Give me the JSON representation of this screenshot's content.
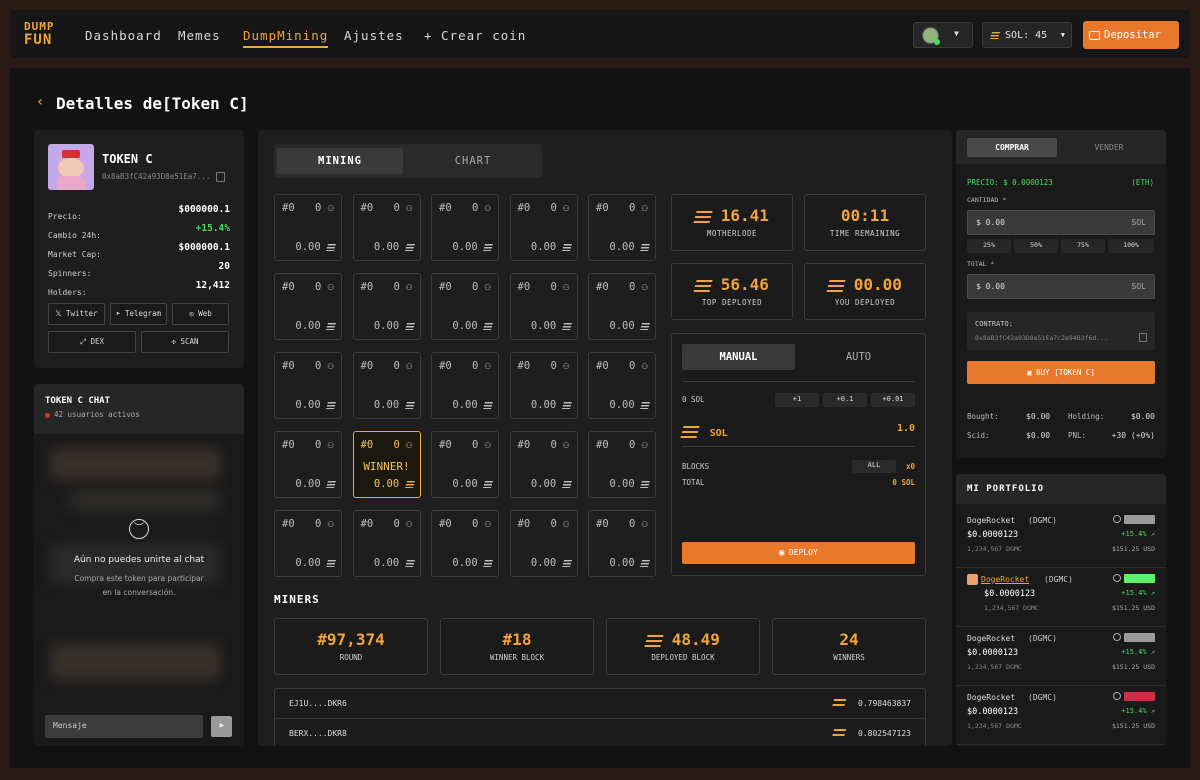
{
  "nav": {
    "logo_top": "DUMP",
    "logo_bottom": "FUN",
    "items": [
      "Dashboard",
      "Memes",
      "DumpMining",
      "Ajustes"
    ],
    "create": "+ Crear coin",
    "sol": "SOL: 45",
    "deposit": "Depositar"
  },
  "page": {
    "title": "Detalles de[Token C]"
  },
  "token": {
    "name": "TOKEN C",
    "address": "0x8aB3fC42a93D8e51Ea7...",
    "stats": [
      {
        "label": "Precio:",
        "value": "$000000.1"
      },
      {
        "label": "Cambio 24h:",
        "value": "+15.4%"
      },
      {
        "label": "Market Cap:",
        "value": "$000000.1"
      },
      {
        "label": "Spinners:",
        "value": "20"
      },
      {
        "label": "Holders:",
        "value": "12,412"
      }
    ],
    "links": [
      "Twitter",
      "Telegram",
      "Web",
      "DEX",
      "SCAN"
    ]
  },
  "chat": {
    "title": "TOKEN C CHAT",
    "active": "42 usuarios activos",
    "locked_title": "Aún no puedes unirte al chat",
    "locked_sub1": "Compra este token para participar",
    "locked_sub2": "en la conversación.",
    "placeholder": "Mensaje"
  },
  "tabs": {
    "mining": "MINING",
    "chart": "CHART"
  },
  "grid": {
    "cells": [
      {
        "id": "#0",
        "count": "0",
        "amount": "0.00"
      },
      {
        "id": "#0",
        "count": "0",
        "amount": "0.00"
      },
      {
        "id": "#0",
        "count": "0",
        "amount": "0.00"
      },
      {
        "id": "#0",
        "count": "0",
        "amount": "0.00"
      },
      {
        "id": "#0",
        "count": "0",
        "amount": "0.00"
      },
      {
        "id": "#0",
        "count": "0",
        "amount": "0.00"
      },
      {
        "id": "#0",
        "count": "0",
        "amount": "0.00"
      },
      {
        "id": "#0",
        "count": "0",
        "amount": "0.00"
      },
      {
        "id": "#0",
        "count": "0",
        "amount": "0.00"
      },
      {
        "id": "#0",
        "count": "0",
        "amount": "0.00"
      },
      {
        "id": "#0",
        "count": "0",
        "amount": "0.00"
      },
      {
        "id": "#0",
        "count": "0",
        "amount": "0.00"
      },
      {
        "id": "#0",
        "count": "0",
        "amount": "0.00"
      },
      {
        "id": "#0",
        "count": "0",
        "amount": "0.00"
      },
      {
        "id": "#0",
        "count": "0",
        "amount": "0.00"
      },
      {
        "id": "#0",
        "count": "0",
        "amount": "0.00"
      },
      {
        "id": "#0",
        "count": "0",
        "amount": "0.00",
        "winner": "WINNER!"
      },
      {
        "id": "#0",
        "count": "0",
        "amount": "0.00"
      },
      {
        "id": "#0",
        "count": "0",
        "amount": "0.00"
      },
      {
        "id": "#0",
        "count": "0",
        "amount": "0.00"
      },
      {
        "id": "#0",
        "count": "0",
        "amount": "0.00"
      },
      {
        "id": "#0",
        "count": "0",
        "amount": "0.00"
      },
      {
        "id": "#0",
        "count": "0",
        "amount": "0.00"
      },
      {
        "id": "#0",
        "count": "0",
        "amount": "0.00"
      },
      {
        "id": "#0",
        "count": "0",
        "amount": "0.00"
      }
    ]
  },
  "stats": [
    {
      "value": "16.41",
      "label": "MOTHERLODE"
    },
    {
      "value": "00:11",
      "label": "TIME REMAINING"
    },
    {
      "value": "56.46",
      "label": "TOP DEPLOYED"
    },
    {
      "value": "00.00",
      "label": "YOU DEPLOYED"
    }
  ],
  "deploy": {
    "manual": "MANUAL",
    "auto": "AUTO",
    "sol_label": "0 SOL",
    "increments": [
      "+1",
      "+0.1",
      "+0.01"
    ],
    "sol": "SOL",
    "amount": "1.0",
    "blocks_label": "BLOCKS",
    "all": "ALL",
    "blocks_value": "x0",
    "total_label": "TOTAL",
    "total_value": "0 SOL",
    "button": "DEPLOY"
  },
  "miners": {
    "title": "MINERS",
    "stats": [
      {
        "value": "#97,374",
        "label": "ROUND"
      },
      {
        "value": "#18",
        "label": "WINNER BLOCK"
      },
      {
        "value": "48.49",
        "label": "DEPLOYED BLOCK"
      },
      {
        "value": "24",
        "label": "WINNERS"
      }
    ],
    "rows": [
      {
        "addr": "EJ1U....DKR6",
        "value": "0.798463837"
      },
      {
        "addr": "BERX....DKR8",
        "value": "0.802547123"
      }
    ]
  },
  "trade": {
    "buy": "COMPRAR",
    "sell": "VENDER",
    "price": "PRECIO: $ 0.0000123",
    "unit": "(ETH)",
    "qty_label": "CANTIDAD",
    "qty_value": "$ 0.00",
    "sol": "SOL",
    "percents": [
      "25%",
      "50%",
      "75%",
      "100%"
    ],
    "total_label": "TOTAL",
    "total_value": "$ 0.00",
    "contract_label": "CONTRATO:",
    "contract_value": "0x8aB3fC42a93D8e51Ea7c2e94B3f6d...",
    "buy_button": "BUY [TOKEN C]",
    "summary": [
      {
        "label": "Bought:",
        "value": "$0.00"
      },
      {
        "label": "Holding:",
        "value": "$0.00"
      },
      {
        "label": "Scid:",
        "value": "$0.00"
      },
      {
        "label": "PNL:",
        "value": "+30 (+0%)"
      }
    ]
  },
  "portfolio": {
    "title": "MI PORTFOLIO",
    "items": [
      {
        "name": "DogeRocket",
        "ticker": "(DGMC)",
        "price": "$0.0000123",
        "change": "+15.4%",
        "amount": "1,234,567 DGMC",
        "usd": "$151.25 USD",
        "bar": "#9a9a9a"
      },
      {
        "name": "DogeRocket",
        "ticker": "(DGMC)",
        "price": "$0.0000123",
        "change": "+15.4%",
        "amount": "1,234,567 DGMC",
        "usd": "$151.25 USD",
        "bar": "#5cf26e"
      },
      {
        "name": "DogeRocket",
        "ticker": "(DGMC)",
        "price": "$0.0000123",
        "change": "+15.4%",
        "amount": "1,234,567 DGMC",
        "usd": "$151.25 USD",
        "bar": "#9a9a9a"
      },
      {
        "name": "DogeRocket",
        "ticker": "(DGMC)",
        "price": "$0.0000123",
        "change": "+15.4%",
        "amount": "1,234,567 DGMC",
        "usd": "$151.25 USD",
        "bar": "#c8304a"
      }
    ]
  }
}
